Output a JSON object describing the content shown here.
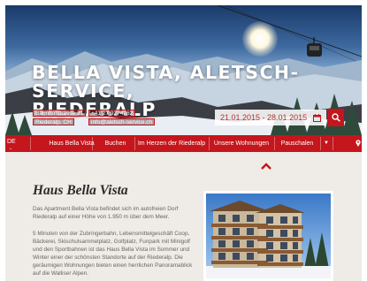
{
  "hero": {
    "title_line1": "BELLA VISTA, ALETSCH-SERVICE,",
    "title_line2": "RIEDERALP",
    "contact": {
      "street": "Bahnhofstrasse 31",
      "phone": "+41 27 9274262",
      "city": "Riederalp, CH",
      "email": "info@aletsch-service.ch"
    },
    "dates": "21.01.2015 - 28.01.2015",
    "calendar_icon": "calendar-icon",
    "search_icon": "search-icon"
  },
  "nav": {
    "language": "DE",
    "items": [
      "Haus Bella Vista",
      "Buchen",
      "Im Herzen der Riederalp",
      "Unsere Wohnungen",
      "Pauschalen"
    ],
    "more_icon": "caret-down-icon",
    "location_icon": "map-pin-icon"
  },
  "content": {
    "title": "Haus Bella Vista",
    "paragraph1": "Das Apartment Bella Vista befindet sich im autofreien Dorf Riederalp auf einer Höhe von 1.950 m über dem Meer.",
    "paragraph2": "5 Minuten von der Zubringerbahn, Lebensmittelgeschäft Coop, Bäckerei, Skischulsammelplatz, Golfplatz, Funpark mit Minigolf und den Sportbahnen ist das Haus Bella Vista im Sommer und Winter einer der schönsten Standorte auf der Riederalp. Die geräumigen Wohnungen bieten einen herrlichen Panoramablick auf die Walliser Alpen."
  },
  "colors": {
    "accent": "#c4161c",
    "background": "#efebe6",
    "text": "#666666"
  }
}
